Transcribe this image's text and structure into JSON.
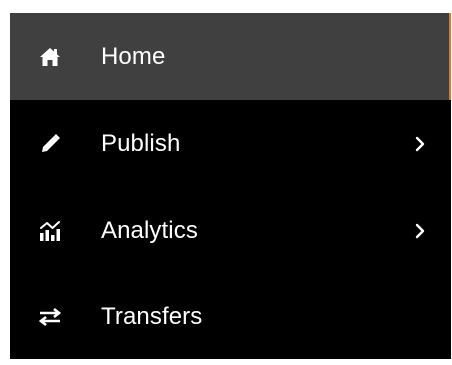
{
  "nav": {
    "items": [
      {
        "label": "Home",
        "icon": "home-icon",
        "active": true,
        "has_submenu": false
      },
      {
        "label": "Publish",
        "icon": "pencil-icon",
        "active": false,
        "has_submenu": true
      },
      {
        "label": "Analytics",
        "icon": "analytics-icon",
        "active": false,
        "has_submenu": true
      },
      {
        "label": "Transfers",
        "icon": "transfer-arrows-icon",
        "active": false,
        "has_submenu": false
      }
    ]
  },
  "colors": {
    "background": "#000000",
    "active_background": "#404040",
    "active_accent": "#e07a1f",
    "text": "#ffffff"
  }
}
